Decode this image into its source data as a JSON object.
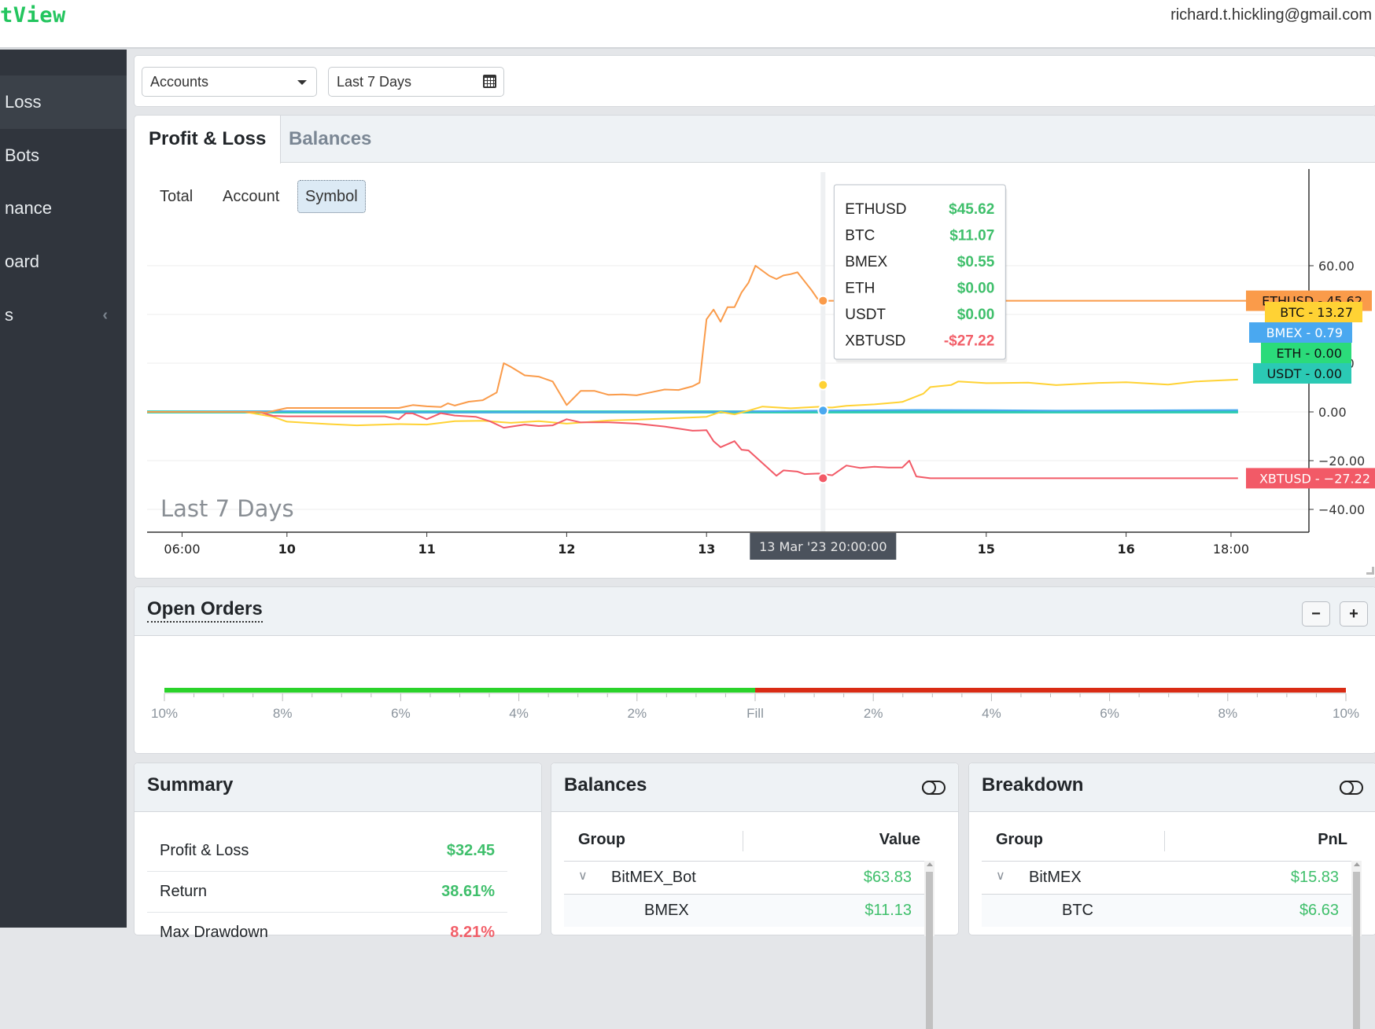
{
  "header": {
    "logo": "tView",
    "user_email": "richard.t.hickling@gmail.com"
  },
  "sidebar": {
    "items": [
      {
        "label": "Loss",
        "active": true
      },
      {
        "label": "Bots",
        "active": false
      },
      {
        "label": "nance",
        "active": false
      },
      {
        "label": "oard",
        "active": false
      },
      {
        "label": "s",
        "active": false,
        "has_chevron": true
      }
    ],
    "chevron": "‹"
  },
  "filters": {
    "accounts_select": "Accounts",
    "date_range": "Last 7 Days"
  },
  "pnl_card": {
    "tabs": [
      {
        "label": "Profit & Loss",
        "active": true
      },
      {
        "label": "Balances",
        "active": false
      }
    ],
    "subtabs": [
      {
        "label": "Total",
        "active": false
      },
      {
        "label": "Account",
        "active": false
      },
      {
        "label": "Symbol",
        "active": true
      }
    ],
    "watermark": "Last 7 Days",
    "crosshair_label": "13 Mar '23  20:00:00",
    "tooltip": [
      {
        "symbol": "ETHUSD",
        "value": "$45.62",
        "sign": "pos"
      },
      {
        "symbol": "BTC",
        "value": "$11.07",
        "sign": "pos"
      },
      {
        "symbol": "BMEX",
        "value": "$0.55",
        "sign": "pos"
      },
      {
        "symbol": "ETH",
        "value": "$0.00",
        "sign": "pos"
      },
      {
        "symbol": "USDT",
        "value": "$0.00",
        "sign": "pos"
      },
      {
        "symbol": "XBTUSD",
        "value": "-$27.22",
        "sign": "neg"
      }
    ]
  },
  "chart_data": {
    "type": "line",
    "title": "",
    "xlabel": "",
    "ylabel": "",
    "x_tick_labels": [
      "06:00",
      "10",
      "11",
      "12",
      "13",
      "15",
      "16",
      "18:00"
    ],
    "x_tick_days": [
      9.25,
      10,
      11,
      12,
      13,
      15,
      16,
      16.75
    ],
    "x_range_days": [
      9.0,
      17.5
    ],
    "y_tick_labels": [
      "60.00",
      "40.00",
      "20.00",
      "0.00",
      "−20.00",
      "−40.00"
    ],
    "y_ticks": [
      60,
      40,
      20,
      0,
      -20,
      -40
    ],
    "ylim": [
      -48,
      70
    ],
    "grid": true,
    "crosshair_day": 13.833,
    "series": [
      {
        "name": "ETHUSD",
        "color": "#fa9b4a",
        "last_label": "45.62",
        "points": [
          [
            9.0,
            0
          ],
          [
            9.8,
            0
          ],
          [
            9.85,
            -0.3
          ],
          [
            10.0,
            1.6
          ],
          [
            10.8,
            1.6
          ],
          [
            10.9,
            2.8
          ],
          [
            11.0,
            2.3
          ],
          [
            11.1,
            2.0
          ],
          [
            11.15,
            3.5
          ],
          [
            11.2,
            2.6
          ],
          [
            11.3,
            4.2
          ],
          [
            11.4,
            4.8
          ],
          [
            11.5,
            8
          ],
          [
            11.55,
            20
          ],
          [
            11.6,
            18.5
          ],
          [
            11.7,
            15
          ],
          [
            11.8,
            14.5
          ],
          [
            11.9,
            12.5
          ],
          [
            12.0,
            2.8
          ],
          [
            12.1,
            8.6
          ],
          [
            12.2,
            8.6
          ],
          [
            12.3,
            7
          ],
          [
            12.4,
            7.2
          ],
          [
            12.5,
            6.8
          ],
          [
            12.6,
            8
          ],
          [
            12.7,
            9.2
          ],
          [
            12.8,
            9
          ],
          [
            12.9,
            10.5
          ],
          [
            12.95,
            12
          ],
          [
            13.0,
            38
          ],
          [
            13.05,
            42
          ],
          [
            13.1,
            37
          ],
          [
            13.15,
            43
          ],
          [
            13.2,
            43
          ],
          [
            13.25,
            49
          ],
          [
            13.3,
            53
          ],
          [
            13.35,
            60
          ],
          [
            13.45,
            55.8
          ],
          [
            13.5,
            54.5
          ],
          [
            13.55,
            56
          ],
          [
            13.6,
            56.5
          ],
          [
            13.65,
            57.3
          ],
          [
            13.75,
            50
          ],
          [
            13.8,
            45.9
          ],
          [
            13.85,
            45.62
          ],
          [
            17.5,
            45.62
          ]
        ]
      },
      {
        "name": "BTC",
        "color": "#ffd234",
        "last_label": "13.27",
        "points": [
          [
            9.0,
            0
          ],
          [
            9.7,
            0
          ],
          [
            9.9,
            -2
          ],
          [
            10.0,
            -4
          ],
          [
            10.3,
            -5
          ],
          [
            10.5,
            -5.5
          ],
          [
            10.8,
            -5
          ],
          [
            11.0,
            -5.2
          ],
          [
            11.2,
            -3.8
          ],
          [
            11.4,
            -3.6
          ],
          [
            11.6,
            -4.5
          ],
          [
            11.8,
            -3.8
          ],
          [
            12.0,
            -4.8
          ],
          [
            12.3,
            -3.5
          ],
          [
            12.5,
            -3.2
          ],
          [
            12.8,
            -2.5
          ],
          [
            13.0,
            -2.0
          ],
          [
            13.1,
            0
          ],
          [
            13.2,
            -1
          ],
          [
            13.3,
            0.5
          ],
          [
            13.4,
            2.2
          ],
          [
            13.6,
            1.5
          ],
          [
            13.8,
            2.1
          ],
          [
            13.85,
            1.8
          ],
          [
            13.9,
            1.8
          ],
          [
            14.0,
            2.5
          ],
          [
            14.2,
            3.1
          ],
          [
            14.4,
            4.1
          ],
          [
            14.55,
            7.5
          ],
          [
            14.6,
            10.2
          ],
          [
            14.75,
            11.07
          ],
          [
            14.8,
            12.5
          ],
          [
            15.0,
            11.8
          ],
          [
            15.3,
            12
          ],
          [
            15.5,
            11
          ],
          [
            15.8,
            11.9
          ],
          [
            16.0,
            12.2
          ],
          [
            16.3,
            11.2
          ],
          [
            16.5,
            12.5
          ],
          [
            16.8,
            13.27
          ]
        ]
      },
      {
        "name": "BMEX",
        "color": "#4aa8f0",
        "last_label": "0.79",
        "points": [
          [
            9.0,
            0
          ],
          [
            10.0,
            0.3
          ],
          [
            11.0,
            -0.2
          ],
          [
            12.0,
            -0.1
          ],
          [
            13.0,
            0
          ],
          [
            13.85,
            0.55
          ],
          [
            14.5,
            0.8
          ],
          [
            15.0,
            0.7
          ],
          [
            15.5,
            0.5
          ],
          [
            16.0,
            0.6
          ],
          [
            16.8,
            0.79
          ]
        ]
      },
      {
        "name": "ETH",
        "color": "#2bdb7a",
        "last_label": "0.00",
        "points": [
          [
            9.0,
            0
          ],
          [
            16.8,
            0
          ]
        ]
      },
      {
        "name": "USDT",
        "color": "#2bc9b4",
        "last_label": "0.00",
        "points": [
          [
            9.0,
            0
          ],
          [
            16.8,
            0
          ]
        ]
      },
      {
        "name": "XBTUSD",
        "color": "#f25a67",
        "last_label": "−27.22",
        "points": [
          [
            9.0,
            0
          ],
          [
            9.8,
            0
          ],
          [
            9.9,
            -1.6
          ],
          [
            10.0,
            -1.8
          ],
          [
            10.7,
            -1.8
          ],
          [
            10.8,
            -3
          ],
          [
            10.85,
            -0.6
          ],
          [
            10.9,
            -0.6
          ],
          [
            11.0,
            -3
          ],
          [
            11.1,
            -0.5
          ],
          [
            11.2,
            -1.5
          ],
          [
            11.35,
            -2
          ],
          [
            11.45,
            -3.8
          ],
          [
            11.55,
            -6.5
          ],
          [
            11.7,
            -5.2
          ],
          [
            11.8,
            -5.8
          ],
          [
            11.9,
            -5.5
          ],
          [
            12.0,
            -3
          ],
          [
            12.1,
            -4.3
          ],
          [
            12.3,
            -4.3
          ],
          [
            12.5,
            -4.8
          ],
          [
            12.7,
            -6
          ],
          [
            12.9,
            -7.7
          ],
          [
            13.0,
            -7.5
          ],
          [
            13.05,
            -12
          ],
          [
            13.1,
            -14.5
          ],
          [
            13.2,
            -12
          ],
          [
            13.25,
            -15.5
          ],
          [
            13.3,
            -15.8
          ],
          [
            13.4,
            -21
          ],
          [
            13.5,
            -26.2
          ],
          [
            13.55,
            -24
          ],
          [
            13.65,
            -24.5
          ],
          [
            13.7,
            -25.5
          ],
          [
            13.8,
            -25.3
          ],
          [
            13.9,
            -26
          ],
          [
            14.0,
            -22
          ],
          [
            14.1,
            -23
          ],
          [
            14.2,
            -22.5
          ],
          [
            14.3,
            -22.8
          ],
          [
            14.4,
            -22.8
          ],
          [
            14.45,
            -20
          ],
          [
            14.5,
            -26.5
          ],
          [
            14.6,
            -27.22
          ],
          [
            16.8,
            -27.22
          ]
        ]
      }
    ]
  },
  "open_orders": {
    "title": "Open Orders",
    "minus_label": "−",
    "plus_label": "+",
    "axis_labels": [
      "10%",
      "8%",
      "6%",
      "4%",
      "2%",
      "Fill",
      "2%",
      "4%",
      "6%",
      "8%",
      "10%"
    ],
    "buy_color": "#2ad32a",
    "sell_color": "#d92b14"
  },
  "summary": {
    "title": "Summary",
    "rows": [
      {
        "label": "Profit & Loss",
        "value": "$32.45",
        "sign": "pos"
      },
      {
        "label": "Return",
        "value": "38.61%",
        "sign": "pos"
      },
      {
        "label": "Max Drawdown",
        "value": "8.21%",
        "sign": "neg"
      }
    ]
  },
  "balances": {
    "title": "Balances",
    "columns": [
      "Group",
      "Value"
    ],
    "rows": [
      {
        "name": "BitMEX_Bot",
        "value": "$63.83",
        "level": 0,
        "expanded": true
      },
      {
        "name": "BMEX",
        "value": "$11.13",
        "level": 1
      }
    ]
  },
  "breakdown": {
    "title": "Breakdown",
    "columns": [
      "Group",
      "PnL"
    ],
    "rows": [
      {
        "name": "BitMEX",
        "value": "$15.83",
        "level": 0,
        "expanded": true
      },
      {
        "name": "BTC",
        "value": "$6.63",
        "level": 1
      }
    ]
  }
}
